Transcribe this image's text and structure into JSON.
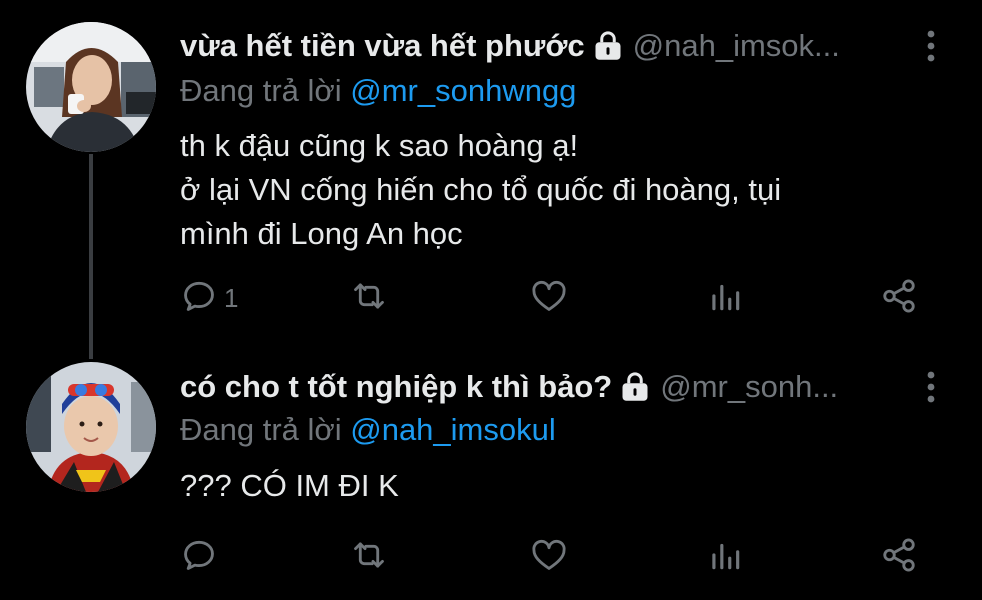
{
  "colors": {
    "background": "#000000",
    "primary_text": "#e7e9ea",
    "secondary_text": "#71767b",
    "link": "#1d9bf0",
    "thread_line": "#3a3d41"
  },
  "tweets": [
    {
      "display_name": "vừa hết tiền vừa hết phước",
      "handle": "@nah_imsok...",
      "replying_to_prefix": "Đang trả lời ",
      "replying_to": "@mr_sonhwngg",
      "body_lines": [
        "th k đậu cũng k sao hoàng ạ!",
        "ở lại VN cống hiến cho tổ quốc đi hoàng, tụi",
        "mình đi Long An học"
      ],
      "reply_count": "1",
      "icons": {
        "lock": "lock-icon",
        "more": "more-vertical-icon",
        "reply": "reply-icon",
        "retweet": "retweet-icon",
        "like": "heart-icon",
        "stats": "stats-icon",
        "share": "share-icon"
      }
    },
    {
      "display_name": "có cho t tốt nghiệp k thì bảo?",
      "handle": "@mr_sonh...",
      "replying_to_prefix": "Đang trả lời ",
      "replying_to": "@nah_imsokul",
      "body_lines": [
        "??? CÓ IM ĐI K"
      ],
      "reply_count": "",
      "icons": {
        "lock": "lock-icon",
        "more": "more-vertical-icon",
        "reply": "reply-icon",
        "retweet": "retweet-icon",
        "like": "heart-icon",
        "stats": "stats-icon",
        "share": "share-icon"
      }
    }
  ]
}
